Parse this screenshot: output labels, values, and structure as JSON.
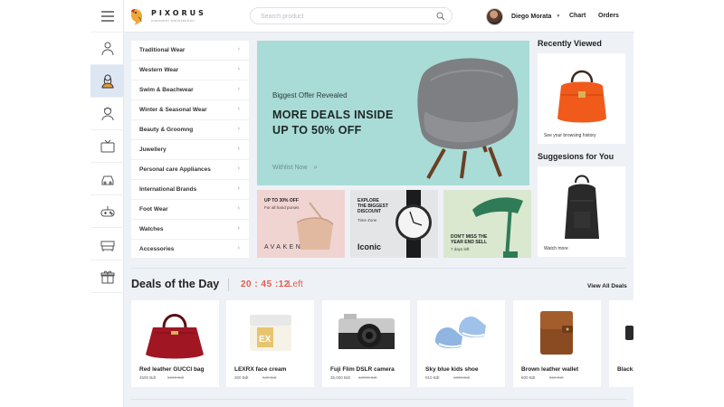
{
  "header": {
    "brand": "PIXORUS",
    "tagline": "customer satisfaction",
    "search_placeholder": "Search product",
    "user_name": "Diego Morata",
    "nav": [
      "Chart",
      "Orders"
    ]
  },
  "rail_icons": [
    "menu-icon",
    "men-icon",
    "women-icon",
    "kids-icon",
    "tv-icon",
    "car-icon",
    "gamepad-icon",
    "sofa-icon",
    "gift-icon"
  ],
  "categories": [
    "Traditional Wear",
    "Western Wear",
    "Swim & Beachwear",
    "Winter & Seasonal Wear",
    "Beauty & Groomng",
    "Juwellery",
    "Personal care Appliances",
    "International Brands",
    "Foot Wear",
    "Watches",
    "Accessories"
  ],
  "hero": {
    "kicker": "Biggest Offer Revealed",
    "title_line1": "MORE DEALS INSIDE",
    "title_line2": "UP TO 50% OFF",
    "cta": "Withlist Now"
  },
  "promos": [
    {
      "title": "UP TO 30% OFF",
      "subtitle": "For all hand purses",
      "brand": "AVAKEN"
    },
    {
      "title_line1": "EXPLORE",
      "title_line2": "THE BIGGEST",
      "title_line3": "DISCOUNT",
      "subtitle": "Time Zone",
      "brand": "Iconic"
    },
    {
      "title_line1": "DON'T MISS THE",
      "title_line2": "YEAR END SELL",
      "subtitle": "7 days left"
    }
  ],
  "recently_viewed": {
    "title": "Recently Viewed",
    "caption": "See your browsing history"
  },
  "suggestions": {
    "title": "Suggesions for You",
    "caption": "Watch more"
  },
  "deals": {
    "title": "Deals of the Day",
    "timer": "20 : 45 :12",
    "timer_suffix": "Left",
    "view_all": "View All Deals",
    "items": [
      {
        "name": "Red leather GUCCI bag",
        "price": "4500 Bdt",
        "old_price": "5500 Bdt"
      },
      {
        "name": "LEXRX face cream",
        "price": "300 Bdt",
        "old_price": "540 Bdt"
      },
      {
        "name": "Fuji Flim DSLR camera",
        "price": "35,000 Bdt",
        "old_price": "43990 Bdt"
      },
      {
        "name": "Sky blue kids shoe",
        "price": "910 Bdt",
        "old_price": "1300 Bdt"
      },
      {
        "name": "Brown leather wallet",
        "price": "600 Bdt",
        "old_price": "810 Bdt"
      },
      {
        "name": "Black"
      }
    ]
  },
  "colors": {
    "accent_red": "#e05c4b",
    "hero_bg": "#a9dcd6",
    "page_bg": "#eef1f6",
    "active_rail": "#dde6f3"
  }
}
